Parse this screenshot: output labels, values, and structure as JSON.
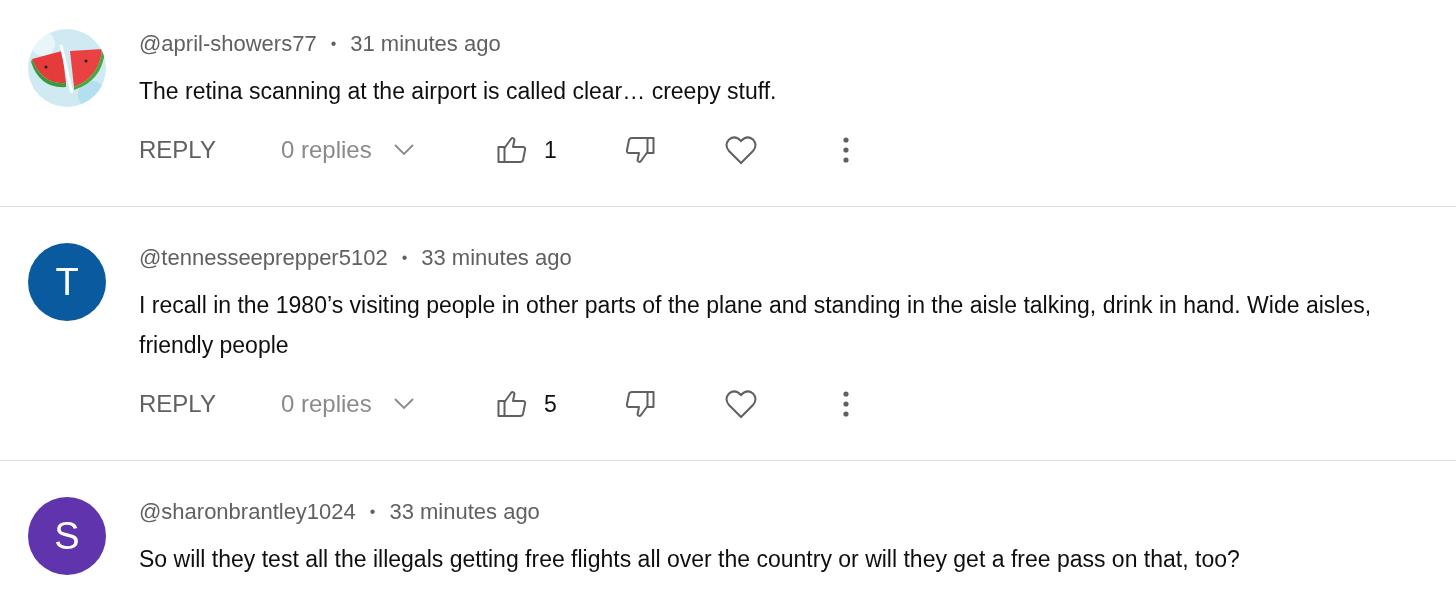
{
  "comments": [
    {
      "username": "@april-showers77",
      "separator": "•",
      "time": "31 minutes ago",
      "text": "The retina scanning at the airport is called clear… creepy stuff.",
      "actions": {
        "reply": "REPLY",
        "replies": "0 replies",
        "likes": "1"
      }
    },
    {
      "avatar": {
        "kind": "letter",
        "letter": "T",
        "color": "#0a5aa0"
      },
      "username": "@tennesseeprepper5102",
      "separator": "•",
      "time": "33 minutes ago",
      "text": "I recall in the 1980’s visiting people in other parts of the plane and standing in the aisle talking, drink in hand. Wide aisles, friendly people",
      "actions": {
        "reply": "REPLY",
        "replies": "0 replies",
        "likes": "5"
      }
    },
    {
      "avatar": {
        "kind": "letter",
        "letter": "S",
        "color": "#5f34ad"
      },
      "username": "@sharonbrantley1024",
      "separator": "•",
      "time": "33 minutes ago",
      "text": "So will they test all the illegals getting free flights all over the country or will they get a free pass on that, too?"
    }
  ]
}
